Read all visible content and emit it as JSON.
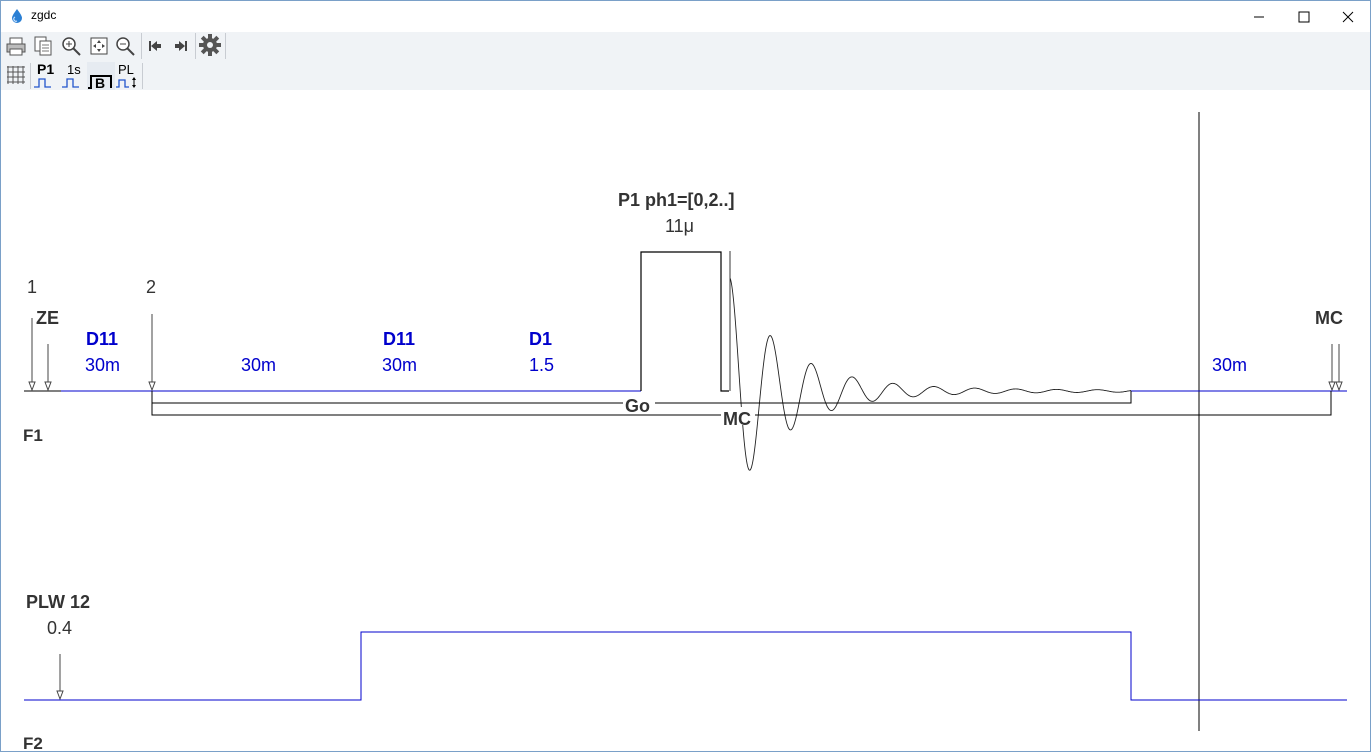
{
  "window": {
    "title": "zgdc"
  },
  "toolbar": {
    "row1": [
      "printer-icon",
      "copy-icon",
      "zoom-in-icon",
      "fit-icon",
      "zoom-out-icon",
      "first-icon",
      "last-icon",
      "settings-icon"
    ],
    "row2": {
      "p1_label": "P1",
      "s1_label": "1s",
      "b_label": "B",
      "pl_label": "PL"
    }
  },
  "diagram": {
    "markers": [
      "1",
      "2"
    ],
    "ze": "ZE",
    "mc_right": "MC",
    "pulse": {
      "title": "P1 ph1=[0,2..]",
      "duration": "11μ"
    },
    "delays": [
      {
        "name": "D11",
        "value": "30m"
      },
      {
        "name": "",
        "value": "30m"
      },
      {
        "name": "D11",
        "value": "30m"
      },
      {
        "name": "D1",
        "value": "1.5"
      },
      {
        "name": "",
        "value": "30m"
      }
    ],
    "go_label": "Go",
    "mc_label": "MC",
    "channel_f1": "F1",
    "channel_f2": "F2",
    "plw": {
      "name": "PLW 12",
      "value": "0.4"
    },
    "colors": {
      "blue": "#0000cc",
      "line": "#000000"
    }
  }
}
